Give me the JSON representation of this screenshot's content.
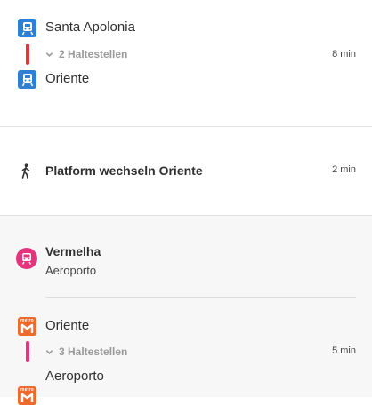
{
  "train_leg": {
    "from_stop": "Santa Apolonia",
    "stops_label": "2 Haltestellen",
    "duration": "8 min",
    "to_stop": "Oriente",
    "line_color": "#e0363e",
    "icon": "train-icon"
  },
  "walk_leg": {
    "title": "Platform wechseln Oriente",
    "duration": "2 min",
    "icon": "walking-person-icon"
  },
  "metro_leg": {
    "line_name": "Vermelha",
    "direction": "Aeroporto",
    "from_stop": "Oriente",
    "stops_label": "3 Haltestellen",
    "duration": "5 min",
    "to_stop": "Aeroporto",
    "line_color": "#e5337d",
    "icon_label": "metro",
    "icon": "metro-icon"
  }
}
